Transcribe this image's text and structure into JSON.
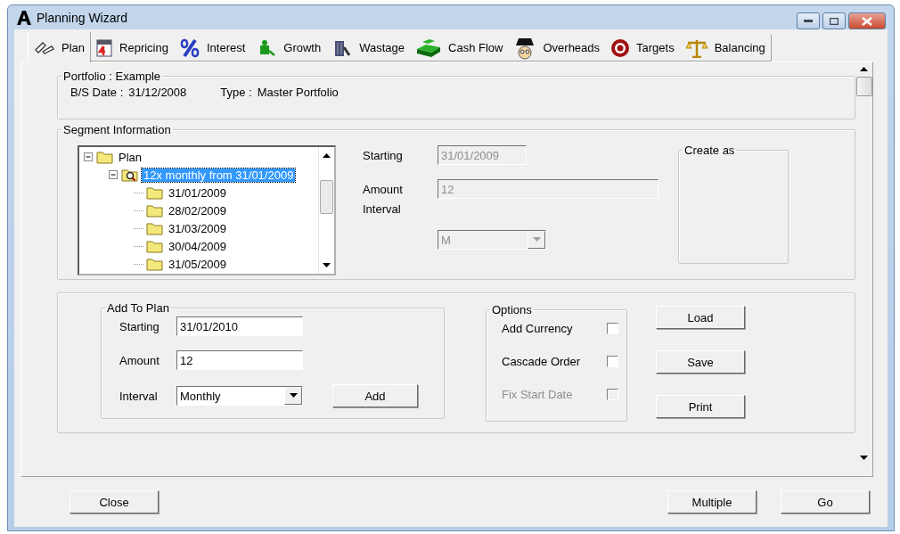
{
  "window": {
    "title": "Planning Wizard"
  },
  "tabs": [
    {
      "label": "Plan",
      "selected": true
    },
    {
      "label": "Repricing",
      "selected": false
    },
    {
      "label": "Interest",
      "selected": false
    },
    {
      "label": "Growth",
      "selected": false
    },
    {
      "label": "Wastage",
      "selected": false
    },
    {
      "label": "Cash Flow",
      "selected": false
    },
    {
      "label": "Overheads",
      "selected": false
    },
    {
      "label": "Targets",
      "selected": false
    },
    {
      "label": "Balancing",
      "selected": false
    }
  ],
  "portfolio": {
    "title": "Portfolio : Example",
    "bs_date_label": "B/S Date :",
    "bs_date": "31/12/2008",
    "type_label": "Type :",
    "type": "Master Portfolio"
  },
  "segment": {
    "title": "Segment Information",
    "tree": [
      {
        "label": "Plan",
        "expanded": true,
        "selected": false,
        "children": [
          {
            "label": "12x monthly from 31/01/2009",
            "expanded": true,
            "selected": true,
            "children": [
              {
                "label": "31/01/2009",
                "selected": false
              },
              {
                "label": "28/02/2009",
                "selected": false
              },
              {
                "label": "31/03/2009",
                "selected": false
              },
              {
                "label": "30/04/2009",
                "selected": false
              },
              {
                "label": "31/05/2009",
                "selected": false
              }
            ]
          }
        ]
      }
    ],
    "starting_label": "Starting",
    "starting": "31/01/2009",
    "amount_label": "Amount",
    "amount": "12",
    "interval_label": "Interval",
    "interval": "M",
    "disabled": true,
    "create_as_title": "Create as"
  },
  "add_to_plan": {
    "title": "Add To Plan",
    "starting_label": "Starting",
    "starting": "31/01/2010",
    "amount_label": "Amount",
    "amount": "12",
    "interval_label": "Interval",
    "interval": "Monthly",
    "add_button": "Add"
  },
  "options": {
    "title": "Options",
    "items": [
      {
        "label": "Add Currency",
        "checked": false,
        "disabled": false
      },
      {
        "label": "Cascade Order",
        "checked": false,
        "disabled": false
      },
      {
        "label": "Fix Start Date",
        "checked": false,
        "disabled": true
      }
    ]
  },
  "side_buttons": [
    "Load",
    "Save",
    "Print"
  ],
  "footer": {
    "close": "Close",
    "multiple": "Multiple",
    "go": "Go"
  }
}
